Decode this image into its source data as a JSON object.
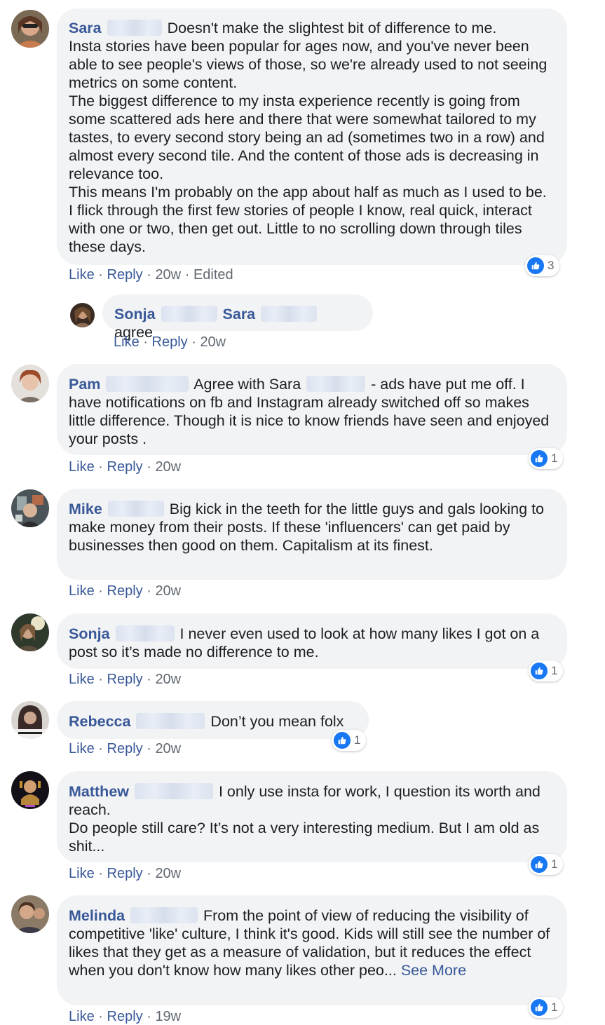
{
  "action_labels": {
    "like": "Like",
    "reply": "Reply",
    "sep": "·"
  },
  "comments": [
    {
      "name": "Sara",
      "text": "Doesn't make the slightest bit of difference to me.\nInsta stories have been popular for ages now, and you've never been able to see people's views of those, so we're already used to not seeing metrics on some content.\nThe biggest difference to my insta experience recently is going from some scattered ads here and there that were somewhat tailored to my tastes, to every second story being an ad (sometimes two in a row) and almost every second tile. And the content of those ads is decreasing in relevance too.\nThis means I'm probably on the app about half as much as I used to be. I flick through the first few stories of people I know, real quick, interact with one or two, then get out. Little to no scrolling down through tiles these days.",
      "time": "20w",
      "edited": "Edited",
      "reactions": "3"
    },
    {
      "name": "Sonja",
      "mention": "Sara",
      "text": "agree",
      "time": "20w"
    },
    {
      "name": "Pam",
      "text_before": "Agree with Sara",
      "text": "- ads have put me off. I have notifications on fb and Instagram already switched off so makes little difference. Though it is nice to know friends have seen and enjoyed your posts .",
      "time": "20w",
      "reactions": "1"
    },
    {
      "name": "Mike",
      "text": "Big kick in the teeth for the little guys and gals looking to make money from their posts. If these 'influencers' can get paid by businesses then good on them. Capitalism at its finest.",
      "time": "20w"
    },
    {
      "name": "Sonja",
      "text": "I never even used to look at how many likes I got on a post so it’s made no difference to me.",
      "time": "20w",
      "reactions": "1"
    },
    {
      "name": "Rebecca",
      "text": "Don’t you mean folx",
      "time": "20w",
      "reactions": "1"
    },
    {
      "name": "Matthew",
      "text": "I only use insta for work, I question its worth and reach.\nDo people still care? It’s not a very interesting medium. But I am old as shit...",
      "time": "20w",
      "reactions": "1"
    },
    {
      "name": "Melinda",
      "text": "From the point of view of reducing the visibility of competitive 'like' culture, I think it's good. Kids will still see the number of likes that they get as a measure of validation, but it reduces the effect when you don't know how many likes other peo...",
      "see_more": "See More",
      "time": "19w",
      "reactions": "1"
    }
  ]
}
